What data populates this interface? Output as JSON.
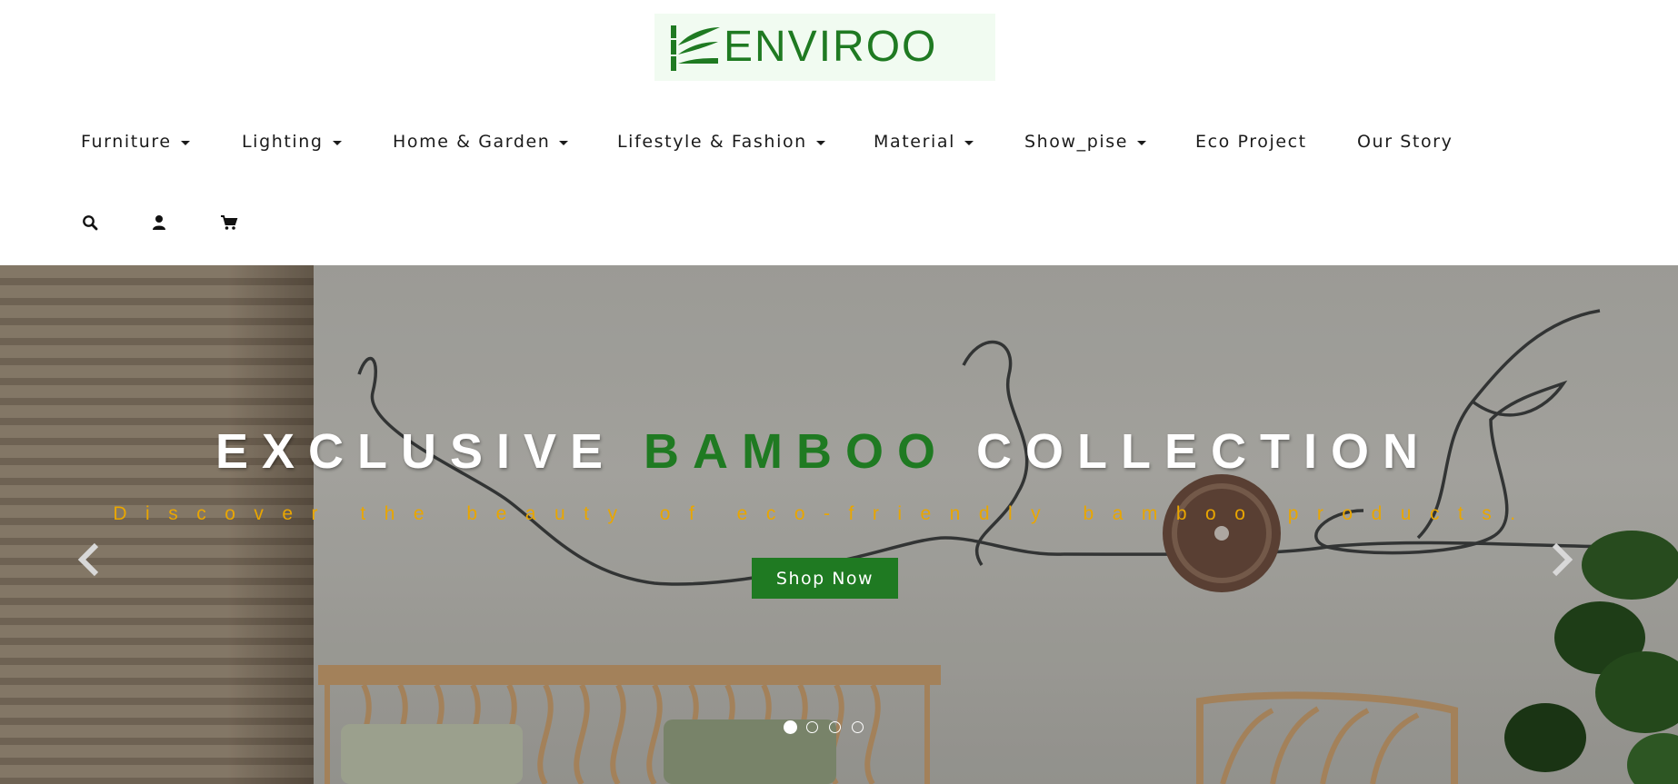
{
  "brand": {
    "logo_text": "ENVIROO",
    "logo_color": "#1f7a22"
  },
  "nav": {
    "items": [
      {
        "label": "Furniture",
        "dropdown": true
      },
      {
        "label": "Lighting",
        "dropdown": true
      },
      {
        "label": "Home & Garden",
        "dropdown": true
      },
      {
        "label": "Lifestyle & Fashion",
        "dropdown": true
      },
      {
        "label": "Material",
        "dropdown": true
      },
      {
        "label": "Show_pise",
        "dropdown": true
      },
      {
        "label": "Eco Project",
        "dropdown": false
      },
      {
        "label": "Our Story",
        "dropdown": false
      }
    ],
    "icons": [
      "search-icon",
      "user-icon",
      "cart-icon"
    ]
  },
  "hero": {
    "title_before": "EXCLUSIVE ",
    "title_accent": "BAMBOO",
    "title_after": " COLLECTION",
    "subtitle": "Discover the beauty of eco-friendly bamboo products.",
    "cta_label": "Shop Now",
    "accent_color": "#1f7a22",
    "subtitle_color": "#e9a600",
    "slides_total": 4,
    "active_slide": 1
  }
}
